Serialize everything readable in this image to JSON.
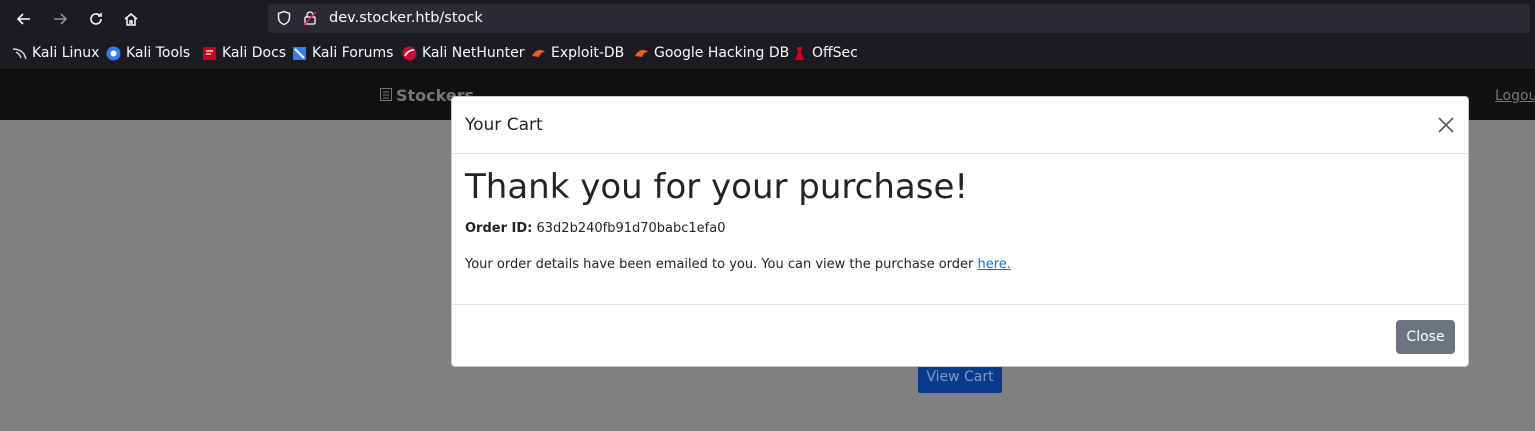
{
  "browser": {
    "url": "dev.stocker.htb/stock",
    "bookmarks": [
      {
        "label": "Kali Linux",
        "icon": "kali-dragon-icon"
      },
      {
        "label": "Kali Tools",
        "icon": "kali-tools-icon"
      },
      {
        "label": "Kali Docs",
        "icon": "kali-docs-icon"
      },
      {
        "label": "Kali Forums",
        "icon": "kali-forums-icon"
      },
      {
        "label": "Kali NetHunter",
        "icon": "nethunter-icon"
      },
      {
        "label": "Exploit-DB",
        "icon": "exploitdb-icon"
      },
      {
        "label": "Google Hacking DB",
        "icon": "ghdb-icon"
      },
      {
        "label": "OffSec",
        "icon": "offsec-icon"
      }
    ]
  },
  "site": {
    "brand": "Stockers",
    "logout": "Logou",
    "view_cart": "View Cart"
  },
  "modal": {
    "title": "Your Cart",
    "heading": "Thank you for your purchase!",
    "order_label": "Order ID:",
    "order_id": "63d2b240fb91d70babc1efa0",
    "emailed_text": "Your order details have been emailed to you. You can view the purchase order",
    "link_text": "here.",
    "close_button": "Close"
  },
  "colors": {
    "backdrop": "#808080",
    "primary": "#0d6efd",
    "secondary": "#6c757d"
  }
}
